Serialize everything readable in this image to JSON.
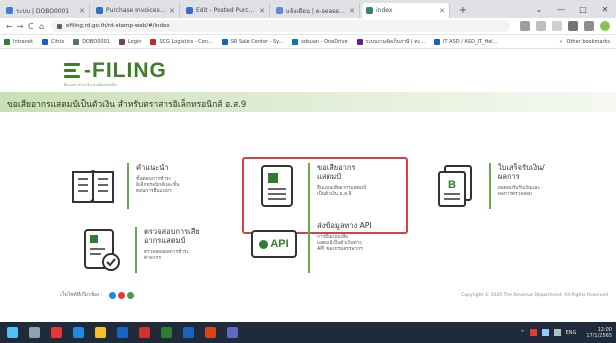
{
  "browser": {
    "tabs": [
      {
        "label": "ระบบ | DOBO0001",
        "color": "#3f7bd6",
        "active": false
      },
      {
        "label": "Purchase Invoices - Dynami",
        "color": "#2f71c4",
        "active": false
      },
      {
        "label": "Edit - Posted Purchase Invo",
        "color": "#2f71c4",
        "active": false
      },
      {
        "label": "แจ้งเตือน | e-seaservice - ThaiS",
        "color": "#5b8dd6",
        "active": false
      },
      {
        "label": "index",
        "color": "#2e8b57",
        "active": true
      }
    ],
    "new_tab": "+",
    "window_controls": [
      "⌄",
      "—",
      "□",
      "✕"
    ],
    "nav": [
      "←",
      "→",
      "C",
      "⌂"
    ],
    "url": "efiling.rd.go.th/rd-stamp-web/#/index",
    "bookmarks": [
      {
        "label": "Intranet",
        "color": "#2e7d32"
      },
      {
        "label": "Citrix",
        "color": "#1565c0"
      },
      {
        "label": "DOBO0001",
        "color": "#546e7a"
      },
      {
        "label": "Login",
        "color": "#6d4c41"
      },
      {
        "label": "SCG Logistics - Cen...",
        "color": "#c62828"
      },
      {
        "label": "SR Sale Center - Sy...",
        "color": "#1565c0"
      },
      {
        "label": "sdsuan - OneDrive",
        "color": "#0277bd"
      },
      {
        "label": "ระบบงานจัดเก็บภาษี | ทะ...",
        "color": "#6a1b9a"
      },
      {
        "label": "IT ASD / ASD_IT_Hel...",
        "color": "#1565c0"
      }
    ],
    "bookmarks_more": "»",
    "other_bookmarks": "Other bookmarks"
  },
  "logo": {
    "text": "-FILING",
    "subtitle": "ยื่นแบบฯ ชำระเงิน ทางอินเทอร์เน็ต"
  },
  "banner": {
    "title": "ขอเสียอากรแสตมป์เป็นตัวเงิน สำหรับตราสารอิเล็กทรอนิกส์ อ.ส.9"
  },
  "menu": [
    {
      "key": "guide",
      "title": "คำแนะนำ",
      "desc": "ขั้นตอนการชำระ\nอิเล็กทรอนิกส์และขั้น\nตอนการยื่นแบบฯ"
    },
    {
      "key": "pay",
      "title": "ขอเสียอากร\nแสตมป์",
      "desc": "ยื่นแบบเสียอากรแสตมป์\nเป็นตัวเงิน อ.ส.9"
    },
    {
      "key": "receipt",
      "title": "ใบเสร็จรับเงิน/\nผลการ",
      "desc": "ผลตอบรับรับเงินและ\nผลการตรวจสอบ"
    },
    {
      "key": "check",
      "title": "ตรวจสอบการเสีย\nอากรแสตมป์",
      "desc": "ตรวจสอบผลการชำระ\nค่าอากร"
    },
    {
      "key": "api",
      "title": "ส่งข้อมูลทาง API",
      "desc": "การยื่นแบบเสีย\nแสตมป์เป็นตัวเงินทาง\nAPI ของกรมสรรพากร",
      "icon_text": "API"
    }
  ],
  "footer": {
    "left": "เว็บไซต์ที่เกี่ยวข้อง :",
    "dots": [
      "#1e88e5",
      "#e53935",
      "#43a047"
    ],
    "right": "Copyright © 2020 The Revenue Department. All Rights Reserved"
  },
  "taskbar": {
    "icons": [
      {
        "name": "start-icon",
        "color": "#4fc3f7"
      },
      {
        "name": "search-icon",
        "color": "#90a4ae"
      },
      {
        "name": "chrome-icon",
        "color": "#e53935"
      },
      {
        "name": "taskview-icon",
        "color": "#1e88e5"
      },
      {
        "name": "explorer-icon",
        "color": "#fbc02d"
      },
      {
        "name": "outlook-icon",
        "color": "#1565c0"
      },
      {
        "name": "acrobat-icon",
        "color": "#d32f2f"
      },
      {
        "name": "excel-icon",
        "color": "#2e7d32"
      },
      {
        "name": "word-icon",
        "color": "#1565c0"
      },
      {
        "name": "powerpoint-icon",
        "color": "#d84315"
      },
      {
        "name": "teams-icon",
        "color": "#5c6bc0"
      }
    ],
    "tray": [
      "^",
      "ENG"
    ],
    "time": "12:00",
    "date": "17/1/2565"
  }
}
